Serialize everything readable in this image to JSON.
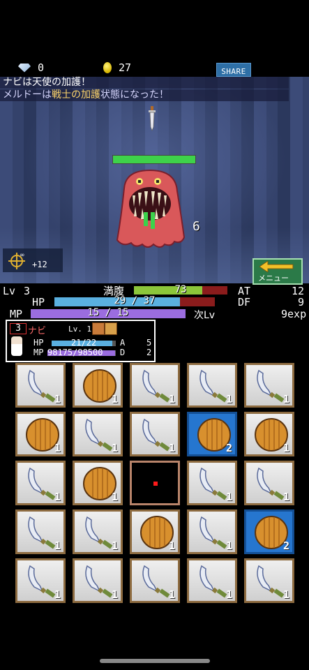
{
  "currency": {
    "gems": "0",
    "coins": "27"
  },
  "share_label": "SHARE",
  "battle_log": [
    {
      "text": "ナビは天使の加護！"
    },
    {
      "pre": "メルドーは",
      "highlight": "戦士の加護",
      "post": "状態になった！"
    }
  ],
  "enemy": {
    "hp_fraction": 1.0,
    "damage_shown": "6"
  },
  "target": {
    "bonus": "+12"
  },
  "menu_label": "メニュー",
  "player": {
    "level_label": "Lv",
    "level": "3",
    "hunger_label": "満腹",
    "hunger": "73",
    "hunger_fraction": 0.73,
    "hp_label": "HP",
    "hp_text": "29 / 37",
    "hp_fraction": 0.784,
    "mp_label": "MP",
    "mp_text": "15 / 15",
    "mp_fraction": 1.0,
    "at_label": "AT",
    "at": "12",
    "df_label": "DF",
    "df": "9",
    "next_label": "次Lv",
    "next_exp": "9exp"
  },
  "companion": {
    "level_box": "3",
    "name": "ナビ",
    "lv_label": "Lv. 1",
    "hp_label": "HP",
    "hp_text": "21/22",
    "hp_fraction": 0.95,
    "mp_label": "MP",
    "mp_text": "98175/98500",
    "mp_fraction": 0.99,
    "a_label": "A",
    "a": "5",
    "d_label": "D",
    "d": "2"
  },
  "inventory": [
    [
      "sword",
      "shield",
      "sword",
      "sword",
      "sword"
    ],
    [
      "shield",
      "sword",
      "sword",
      "shield-blue",
      "shield"
    ],
    [
      "sword",
      "shield",
      "empty-dark",
      "sword",
      "sword"
    ],
    [
      "sword",
      "sword",
      "shield",
      "sword",
      "shield-blue"
    ],
    [
      "sword",
      "sword",
      "sword",
      "sword",
      "sword"
    ]
  ],
  "inventory_counts": [
    [
      "1",
      "1",
      "1",
      "1",
      "1"
    ],
    [
      "1",
      "1",
      "1",
      "2",
      "1"
    ],
    [
      "1",
      "1",
      "",
      "1",
      "1"
    ],
    [
      "1",
      "1",
      "1",
      "1",
      "2"
    ],
    [
      "1",
      "1",
      "1",
      "1",
      "1"
    ]
  ],
  "colors": {
    "hp": "#5ab0e0",
    "hunger": "#8cc63a",
    "mp": "#9b6de0",
    "bar_bg": "#8b1c1c",
    "cell_blue": "#2676cf"
  }
}
